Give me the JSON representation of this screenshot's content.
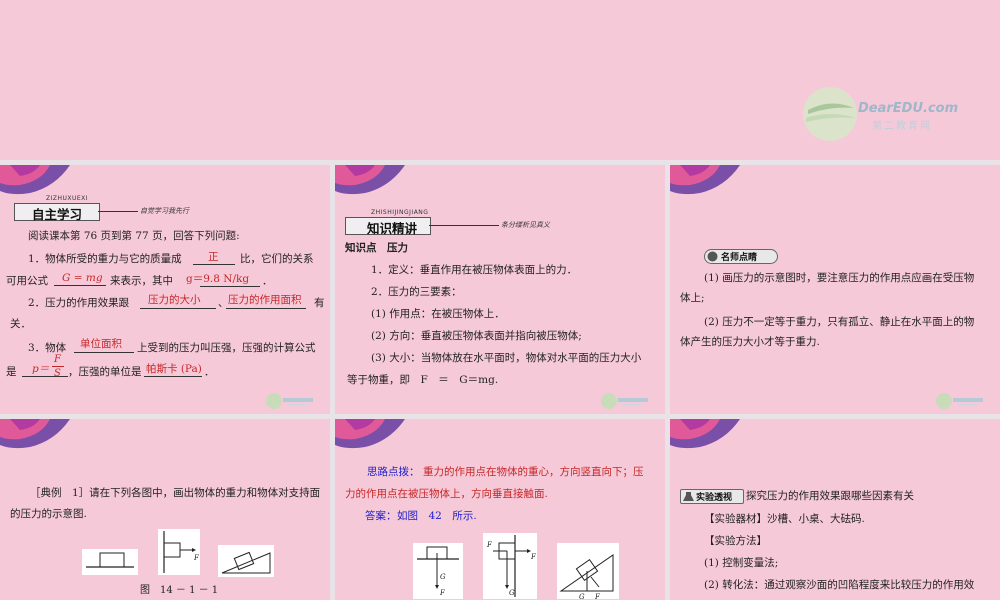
{
  "logo": {
    "brand": "DearEDU.com",
    "sub": "第二教育网"
  },
  "slide1": {
    "banner_pinyin": "ZIZHUXUEXI",
    "banner_title": "自主学习",
    "banner_slogan": "自觉学习我先行",
    "intro": "阅读课本第   76 页到第   77 页，回答下列问题:",
    "q1_a": "1．物体所受的重力与它的质量成",
    "q1_ans": "正",
    "q1_b": "比，它们的关系",
    "q1_c": "可用公式",
    "q1_formula": "G = mg",
    "q1_d": "来表示，其中",
    "q1_g": "g＝9.8 N/kg",
    "q1_e": "．",
    "q2_a": "2．压力的作用效果跟",
    "q2_ans1": "压力的大小",
    "q2_sep": "、",
    "q2_ans2": "压力的作用面积",
    "q2_b": "有",
    "q2_c": "关．",
    "q3_a": "3．物体",
    "q3_ans": "单位面积",
    "q3_b": "上受到的压力叫压强，压强的计算公式",
    "q3_c": "是",
    "q3_formula_p": "p＝",
    "q3_formula_num": "F",
    "q3_formula_den": "S",
    "q3_d": "，压强的单位是",
    "q3_unit": "帕斯卡 (Pa)",
    "q3_e": "．"
  },
  "slide2": {
    "banner_pinyin": "ZHISHIJINGJIANG",
    "banner_title": "知识精讲",
    "banner_slogan": "条分缕析见真义",
    "heading": "知识点　压力",
    "l1": "1．定义：垂直作用在被压物体表面上的力．",
    "l2": "2．压力的三要素：",
    "l3": "(1) 作用点：在被压物体上．",
    "l4": "(2) 方向：垂直被压物体表面并指向被压物体;",
    "l5": "(3) 大小：当物体放在水平面时，物体对水平面的压力大小",
    "l6": "等于物重，即　F　＝　G＝mg."
  },
  "slide3": {
    "badge": "名师点睛",
    "p1a": "(1) 画压力的示意图时，要注意压力的作用点应画在受压物",
    "p1b": "体上;",
    "p2a": "(2) 压力不一定等于重力，只有孤立、静止在水平面上的物",
    "p2b": "体产生的压力大小才等于重力."
  },
  "slide4": {
    "example_a": "［典例　1］请在下列各图中，画出物体的重力和物体对支持面",
    "example_b": "的压力的示意图.",
    "force_label": "F",
    "caption": "图　14 － 1 － 1"
  },
  "slide5": {
    "hint_label": "思路点拨：",
    "hint_a": "重力的作用点在物体的重心，方向竖直向下；压",
    "hint_b": "力的作用点在被压物体上，方向垂直接触面.",
    "answer_label": "答案：",
    "answer_text": "如图　42　所示.",
    "F": "F",
    "G": "G"
  },
  "slide6": {
    "badge": "实验透视",
    "title": "探究压力的作用效果跟哪些因素有关",
    "l1": "【实验器材】沙槽、小桌、大砝码.",
    "l2": "【实验方法】",
    "l3": "(1) 控制变量法;",
    "l4": "(2) 转化法：通过观察沙面的凹陷程度来比较压力的作用效"
  }
}
